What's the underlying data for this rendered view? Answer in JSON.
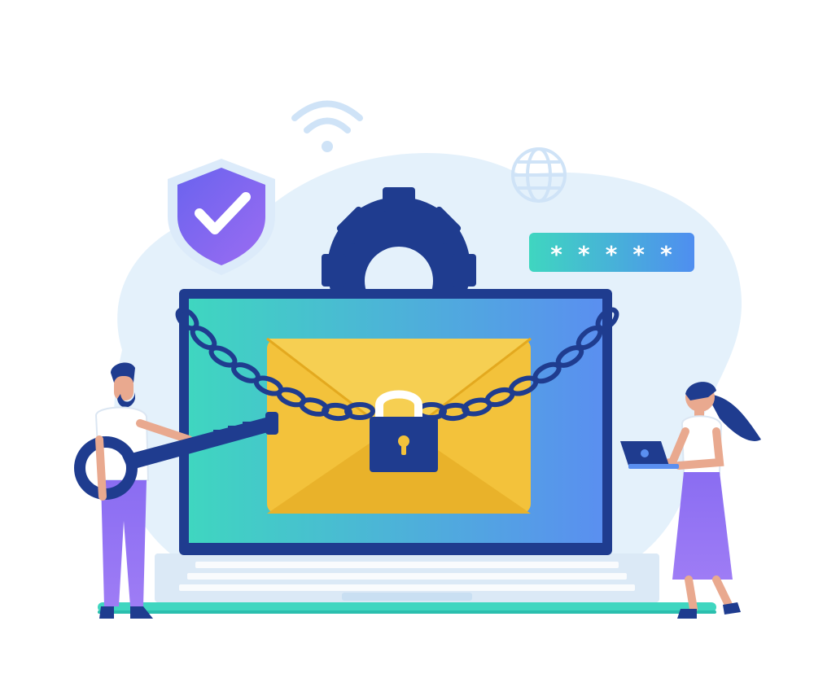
{
  "password_field": {
    "masked_value": "* * * * *"
  },
  "colors": {
    "background": "#ffffff",
    "blob": "#e4f1fb",
    "navy": "#1f3c8f",
    "shield_fill": "#7b63ea",
    "check": "#ffffff",
    "screen_start": "#3fd6c0",
    "screen_end": "#5a8ff0",
    "envelope": "#f3c23b",
    "envelope_dark": "#e3a91f",
    "password_field_start": "#3fd6c0",
    "password_field_end": "#4f8ef0",
    "keyboard": "#dbe9f6",
    "laptop_base": "#c9dff2",
    "man_shirt": "#ffffff",
    "man_pants": "#8b6cf0",
    "woman_skirt": "#8b6cf0",
    "skin": "#e9a98f",
    "hair": "#1f3c8f"
  },
  "icons": [
    "shield-check-icon",
    "wifi-icon",
    "globe-icon",
    "gear-icon",
    "padlock-icon",
    "chain-icon",
    "key-icon",
    "envelope-icon",
    "laptop-icon"
  ]
}
